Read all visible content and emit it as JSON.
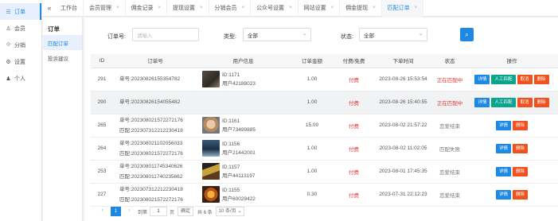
{
  "leftnav": {
    "items": [
      {
        "icon": "menu-icon",
        "glyph": "☰",
        "label": "订单"
      },
      {
        "icon": "user-icon",
        "glyph": "♙",
        "label": "会员"
      },
      {
        "icon": "share-icon",
        "glyph": "⟐",
        "label": "分销"
      },
      {
        "icon": "gear-icon",
        "glyph": "⚙",
        "label": "设置"
      },
      {
        "icon": "person-icon",
        "glyph": "♟",
        "label": "个人"
      }
    ]
  },
  "tabbar": {
    "collapse_glyph": "«",
    "tabs": [
      {
        "label": "工作台"
      },
      {
        "label": "会员管理"
      },
      {
        "label": "佣金记录"
      },
      {
        "label": "提现设置"
      },
      {
        "label": "分销会员"
      },
      {
        "label": "公众号设置"
      },
      {
        "label": "网站设置"
      },
      {
        "label": "佣金提现"
      },
      {
        "label": "匹配订单"
      }
    ],
    "close_glyph": "×"
  },
  "submenu": {
    "title": "订单",
    "items": [
      {
        "label": "匹配订单"
      },
      {
        "label": "投诉建议"
      }
    ]
  },
  "filters": {
    "order_label": "订单号:",
    "order_placeholder": "请输入",
    "type_label": "类型:",
    "type_value": "全部",
    "status_label": "状态:",
    "status_value": "全部",
    "chevron": "⌄",
    "search_glyph": "⌕"
  },
  "table": {
    "headers": [
      "ID",
      "订单号",
      "用户信息",
      "订单金额",
      "付费/免费",
      "下单时间",
      "状态",
      "操作"
    ],
    "rows": [
      {
        "id": "291",
        "order1": "单号:20230826155354782",
        "order2": "",
        "uid": "ID:1171",
        "uname": "用户42188023",
        "amount": "1.00",
        "pay": "付费",
        "time": "2023-08-26 15:53:54",
        "status": "正在匹配中",
        "status_class": "matching",
        "actions": [
          "详情",
          "人工匹配",
          "取消",
          "删除"
        ]
      },
      {
        "id": "290",
        "order1": "单号:20230826154055482",
        "order2": "",
        "uid": "",
        "uname": "",
        "amount": "1.00",
        "pay": "付费",
        "time": "2023-08-26 15:40:55",
        "status": "正在匹配中",
        "status_class": "matching",
        "actions": [
          "详情",
          "人工匹配",
          "取消",
          "删除"
        ]
      },
      {
        "id": "265",
        "order1": "单号:202308021572272176",
        "order2": "匹配:202307312212230418",
        "uid": "ID:1161",
        "uname": "用户73499885",
        "amount": "15.00",
        "pay": "付费",
        "time": "2023-08-02 21:57:22",
        "status": "恋爱结束",
        "status_class": "ended",
        "actions": [
          "详情",
          "删除"
        ]
      },
      {
        "id": "264",
        "order1": "单号:202308021102056033",
        "order2": "匹配:202308021572272176",
        "uid": "ID:1156",
        "uname": "用户21442001",
        "amount": "1.00",
        "pay": "付费",
        "time": "2023-08-02 11:02:05",
        "status": "匹配失败",
        "status_class": "ended",
        "actions": [
          "详情",
          "删除"
        ]
      },
      {
        "id": "253",
        "order1": "单号:202308011745340626",
        "order2": "匹配:202308011740235662",
        "uid": "ID:1157",
        "uname": "用户44113197",
        "amount": "1.00",
        "pay": "付费",
        "time": "2023-08-01 17:45:35",
        "status": "恋爱结束",
        "status_class": "ended",
        "actions": [
          "详情",
          "删除"
        ]
      },
      {
        "id": "227",
        "order1": "单号:202307312212230418",
        "order2": "匹配:202308021572272176",
        "uid": "ID:1155",
        "uname": "用户60029422",
        "amount": "0.30",
        "pay": "付费",
        "time": "2023-07-31 22:12:23",
        "status": "恋爱结束",
        "status_class": "ended",
        "actions": [
          "详情",
          "删除"
        ]
      }
    ]
  },
  "pager": {
    "prev": "‹",
    "current": "1",
    "next": "›",
    "goto_label": "到第",
    "goto_value": "1",
    "page_unit": "页",
    "confirm": "确定",
    "total": "共 6 条",
    "page_size": "10 条/页 ⌄"
  }
}
